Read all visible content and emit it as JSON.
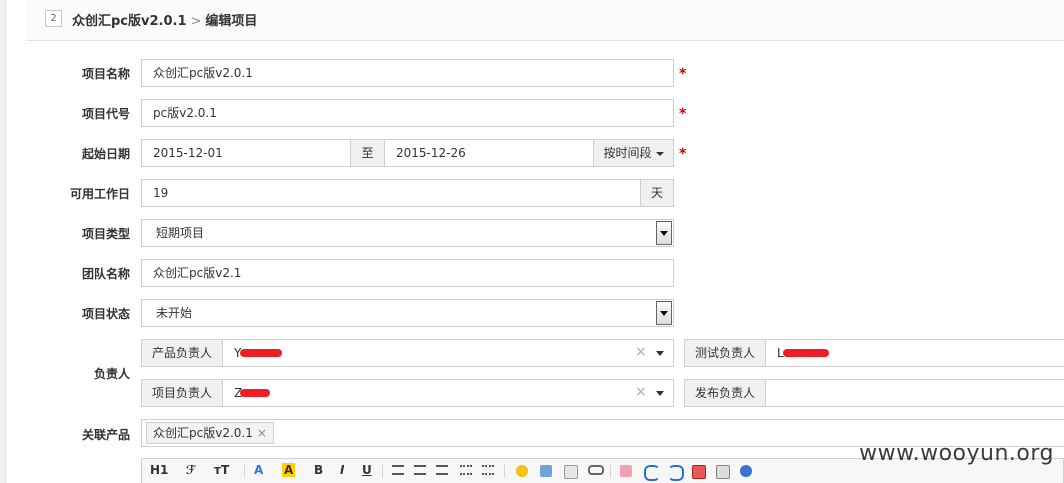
{
  "header": {
    "id_badge": "2",
    "title": "众创汇pc版v2.0.1",
    "separator": ">",
    "subtitle": "编辑项目"
  },
  "form": {
    "name": {
      "label": "项目名称",
      "value": "众创汇pc版v2.0.1",
      "required": "*"
    },
    "code": {
      "label": "项目代号",
      "value": "pc版v2.0.1",
      "required": "*"
    },
    "dates": {
      "label": "起始日期",
      "start": "2015-12-01",
      "to": "至",
      "end": "2015-12-26",
      "mode_button": "按时间段",
      "required": "*"
    },
    "workdays": {
      "label": "可用工作日",
      "value": "19",
      "unit": "天"
    },
    "type": {
      "label": "项目类型",
      "selected": "短期项目"
    },
    "team": {
      "label": "团队名称",
      "value": "众创汇pc版v2.1"
    },
    "status": {
      "label": "项目状态",
      "selected": "未开始"
    },
    "owners": {
      "label": "负责人",
      "product": {
        "label": "产品负责人",
        "value": "Y",
        "clear": "×"
      },
      "test": {
        "label": "测试负责人",
        "value": "L"
      },
      "project": {
        "label": "项目负责人",
        "value": "Z",
        "clear": "×"
      },
      "release": {
        "label": "发布负责人",
        "value": ""
      }
    },
    "products": {
      "label": "关联产品",
      "tags": [
        {
          "text": "众创汇pc版v2.0.1",
          "remove": "×"
        }
      ]
    }
  },
  "editor_toolbar": {
    "heading": "H1",
    "font": "ℱ",
    "size": "тT",
    "font_color": "A",
    "bg_color": "A",
    "bold": "B",
    "italic": "I",
    "underline": "U"
  },
  "watermark": "www.wooyun.org"
}
